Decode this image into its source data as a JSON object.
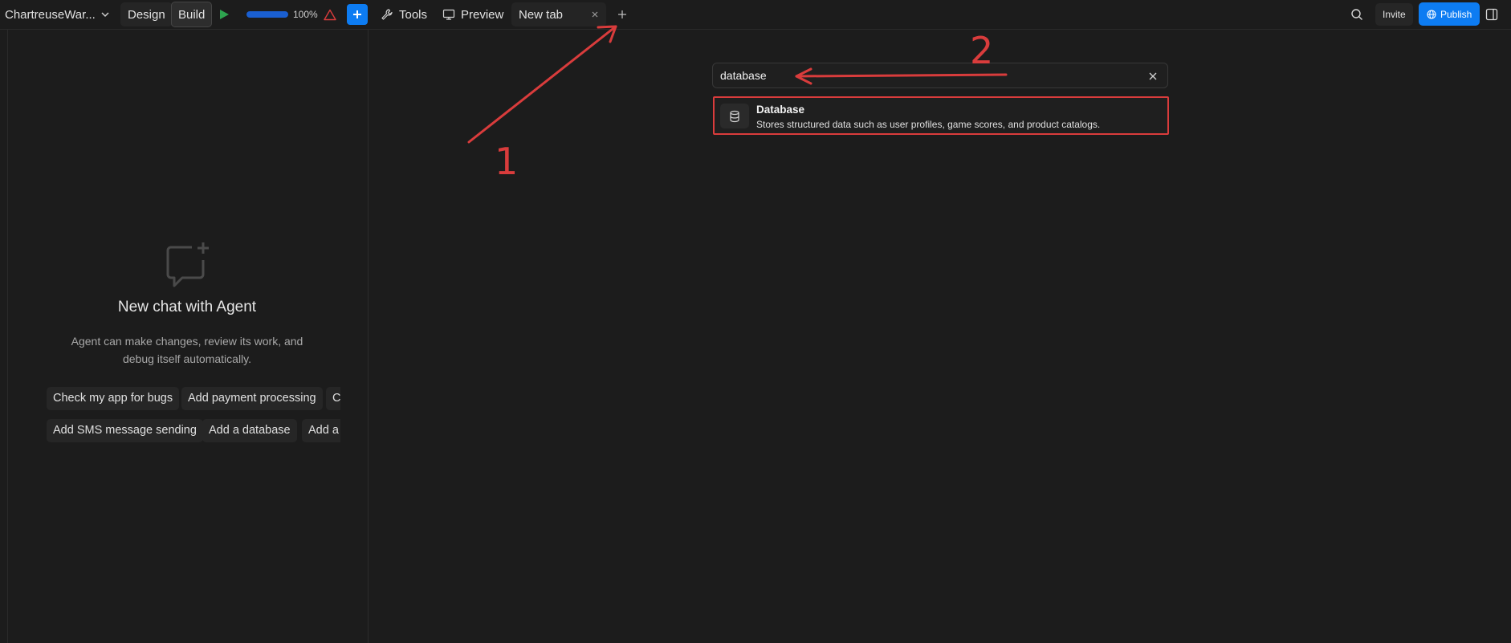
{
  "topbar": {
    "app_name": "ChartreuseWar...",
    "design_label": "Design",
    "build_label": "Build",
    "progress_percent": 100,
    "progress_label": "100%",
    "tools_label": "Tools",
    "preview_label": "Preview",
    "tab_label": "New tab",
    "invite_label": "Invite",
    "publish_label": "Publish"
  },
  "agent": {
    "title": "New chat with Agent",
    "description": "Agent can make changes, review its work, and debug itself automatically.",
    "suggestions_row1": [
      "Check my app for bugs",
      "Add payment processing",
      "C"
    ],
    "suggestions_row2": [
      "Add SMS message sending",
      "Add a database",
      "Add a"
    ]
  },
  "search": {
    "value": "database",
    "results": [
      {
        "title": "Database",
        "description": "Stores structured data such as user profiles, game scores, and product catalogs."
      }
    ]
  },
  "annotations": {
    "label_1": "1",
    "label_2": "2",
    "color": "#d93c3c"
  },
  "colors": {
    "accent": "#0d7cf2",
    "background": "#1c1c1c",
    "run_green": "#2ea44f",
    "warning_red": "#d93c3c"
  }
}
